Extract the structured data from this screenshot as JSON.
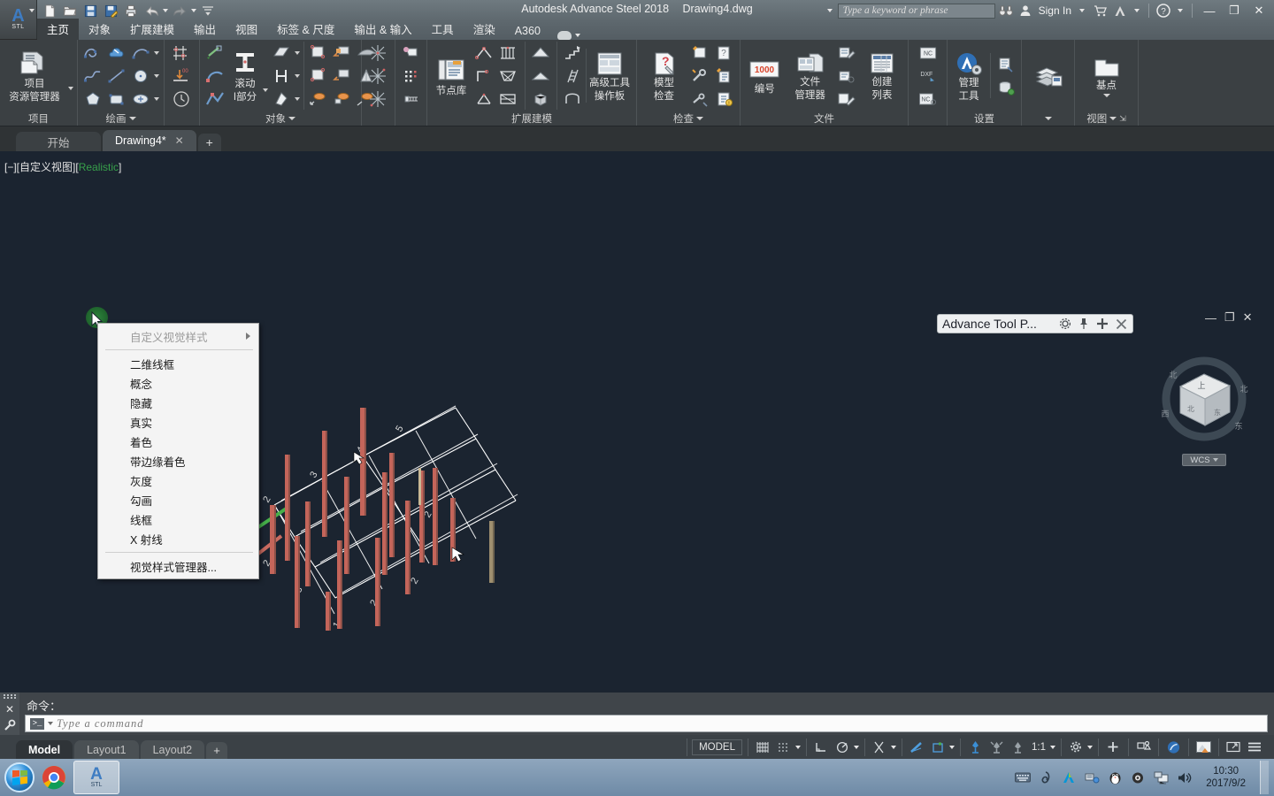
{
  "titlebar": {
    "app_name": "Autodesk Advance Steel 2018",
    "document": "Drawing4.dwg",
    "app_button_label": "STL",
    "quick_access": [
      {
        "name": "new-file-icon",
        "tip": "New"
      },
      {
        "name": "open-folder-icon",
        "tip": "Open"
      },
      {
        "name": "save-icon",
        "tip": "Save"
      },
      {
        "name": "save-as-icon",
        "tip": "Save As"
      },
      {
        "name": "plot-icon",
        "tip": "Plot"
      },
      {
        "name": "undo-icon",
        "tip": "Undo"
      },
      {
        "name": "redo-icon",
        "tip": "Redo"
      },
      {
        "name": "customize-qat-icon",
        "tip": "Customize"
      }
    ],
    "search_placeholder": "Type a keyword or phrase",
    "sign_in": "Sign In",
    "right_icons": [
      "binoculars-icon",
      "user-icon",
      "cart-icon",
      "autodesk-a-icon",
      "help-icon"
    ],
    "window_controls": [
      "minimize-icon",
      "restore-icon",
      "close-icon"
    ]
  },
  "menu": {
    "tabs": [
      {
        "label": "主页",
        "active": true
      },
      {
        "label": "对象",
        "active": false
      },
      {
        "label": "扩展建模",
        "active": false
      },
      {
        "label": "输出",
        "active": false
      },
      {
        "label": "视图",
        "active": false
      },
      {
        "label": "标签 & 尺度",
        "active": false
      },
      {
        "label": "输出 & 输入",
        "active": false
      },
      {
        "label": "工具",
        "active": false
      },
      {
        "label": "渲染",
        "active": false
      },
      {
        "label": "A360",
        "active": false
      }
    ]
  },
  "ribbon": {
    "panels": [
      {
        "title": "项目",
        "has_dropdown": false,
        "big_buttons": [
          {
            "label_line1": "项目",
            "label_line2": "资源管理器",
            "icon": "project-explorer-icon",
            "has_flyout": true
          }
        ],
        "small_buttons": []
      },
      {
        "title": "绘画",
        "has_dropdown": true,
        "big_buttons": [],
        "small_buttons": [
          "polyline-icon",
          "revision-cloud-icon",
          "arc-icon",
          "spline-icon",
          "line-icon",
          "circle-icon",
          "polygon-icon",
          "rectangle-icon",
          "ellipse-icon"
        ]
      },
      {
        "title": "",
        "has_dropdown": false,
        "big_buttons": [],
        "small_buttons": [
          "grid-axis-icon",
          "floor-level-icon",
          "clock-icon"
        ]
      },
      {
        "title": "对象",
        "has_dropdown": true,
        "big_buttons": [
          {
            "label_line1": "滚动",
            "label_line2": "I部分",
            "icon": "i-beam-icon",
            "has_flyout": true
          }
        ],
        "small_buttons": [
          "beam-start-icon",
          "beam-curve-icon",
          "beam-poly-icon",
          "plate-icon",
          "plate-fold-icon",
          "plate-bend-icon",
          "bolt-icon",
          "weld-icon",
          "anchor-icon"
        ]
      },
      {
        "title": "",
        "has_dropdown": false,
        "big_buttons": [],
        "small_buttons": [
          "grating-icon",
          "grating-2-icon",
          "shear-stud-icon"
        ]
      },
      {
        "title": "扩展建模",
        "has_dropdown": false,
        "big_buttons": [
          {
            "label_line1": "节点库",
            "label_line2": "",
            "icon": "connection-vault-icon",
            "has_flyout": false
          },
          {
            "label_line1": "高级工具",
            "label_line2": "操作板",
            "icon": "advanced-tool-palette-icon",
            "has_flyout": false
          }
        ],
        "small_buttons": [
          "portal-frame-icon",
          "truss-icon",
          "frame-icon",
          "lattice-icon",
          "bracing-icon",
          "purlin-icon",
          "roof-icon",
          "wall-icon",
          "box-icon",
          "stair-icon",
          "ladder-icon",
          "railing-icon"
        ]
      },
      {
        "title": "检查",
        "has_dropdown": true,
        "big_buttons": [
          {
            "label_line1": "模型",
            "label_line2": "检查",
            "icon": "model-check-icon",
            "has_flyout": false
          }
        ],
        "small_buttons": [
          "audit-icon",
          "unknown-icon",
          "tools-check-icon",
          "update-icon",
          "clash-check-icon",
          "warning-list-icon"
        ]
      },
      {
        "title": "文件",
        "has_dropdown": false,
        "big_buttons": [
          {
            "label_line1": "编号",
            "label_line2": "",
            "icon": "numbering-icon",
            "has_flyout": false
          },
          {
            "label_line1": "文件",
            "label_line2": "管理器",
            "icon": "document-manager-icon",
            "has_flyout": false
          },
          {
            "label_line1": "创建",
            "label_line2": "列表",
            "icon": "create-list-icon",
            "has_flyout": false
          }
        ],
        "small_buttons": [
          "drawing-process-icon",
          "drawing-style-icon",
          "drawing-edit-icon",
          "nc-icon",
          "dxf-icon",
          "nc-export-icon"
        ]
      },
      {
        "title": "设置",
        "has_dropdown": false,
        "big_buttons": [
          {
            "label_line1": "管理",
            "label_line2": "工具",
            "icon": "management-tools-icon",
            "has_flyout": false
          }
        ],
        "small_buttons": [
          "defaults-icon",
          "database-icon"
        ]
      },
      {
        "title": "",
        "has_dropdown": true,
        "big_buttons": [
          {
            "label_line1": "图层",
            "label_line2": "",
            "icon": "layers-icon",
            "has_flyout": false
          }
        ],
        "small_buttons": []
      },
      {
        "title": "视图",
        "has_dropdown": true,
        "big_buttons": [
          {
            "label_line1": "基点",
            "label_line2": "",
            "icon": "base-point-icon",
            "has_flyout": true
          }
        ],
        "small_buttons": []
      }
    ]
  },
  "file_tabs": {
    "tabs": [
      {
        "label": "开始",
        "active": false,
        "closable": false
      },
      {
        "label": "Drawing4*",
        "active": true,
        "closable": true
      }
    ],
    "close_glyph": "✕",
    "new_tab_glyph": "+"
  },
  "canvas": {
    "viewport_label_prefix": "[−][自定义视图][",
    "viewport_visual_style": "Realistic",
    "viewport_label_suffix": "]",
    "viewcube": {
      "faces": [
        "上",
        "北",
        "西",
        "东"
      ],
      "wcs_label": "WCS"
    }
  },
  "context_menu": {
    "items": [
      {
        "label": "自定义视觉样式",
        "dim": true,
        "submenu": true,
        "separator_after": true
      },
      {
        "label": "二维线框",
        "dim": false,
        "submenu": false,
        "separator_after": false
      },
      {
        "label": "概念",
        "dim": false,
        "submenu": false,
        "separator_after": false
      },
      {
        "label": "隐藏",
        "dim": false,
        "submenu": false,
        "separator_after": false
      },
      {
        "label": "真实",
        "dim": false,
        "submenu": false,
        "separator_after": false
      },
      {
        "label": "着色",
        "dim": false,
        "submenu": false,
        "separator_after": false
      },
      {
        "label": "带边缘着色",
        "dim": false,
        "submenu": false,
        "separator_after": false
      },
      {
        "label": "灰度",
        "dim": false,
        "submenu": false,
        "separator_after": false
      },
      {
        "label": "勾画",
        "dim": false,
        "submenu": false,
        "separator_after": false
      },
      {
        "label": "线框",
        "dim": false,
        "submenu": false,
        "separator_after": false
      },
      {
        "label": "X 射线",
        "dim": false,
        "submenu": false,
        "separator_after": true
      },
      {
        "label": "视觉样式管理器...",
        "dim": false,
        "submenu": false,
        "separator_after": false
      }
    ]
  },
  "tool_palette": {
    "title": "Advance Tool P...",
    "icons": [
      "gear-icon",
      "pin-icon",
      "move-icon",
      "close-icon"
    ],
    "window_controls": [
      "minimize-icon",
      "restore-icon",
      "close-icon"
    ]
  },
  "command_line": {
    "prompt_label": "命令：",
    "input_placeholder": "Type a command",
    "prompt_glyph": ">_",
    "close_glyph": "✕",
    "settings_glyph": "wrench-icon"
  },
  "status_bar": {
    "layout_tabs": [
      {
        "label": "Model",
        "active": true
      },
      {
        "label": "Layout1",
        "active": false
      },
      {
        "label": "Layout2",
        "active": false
      }
    ],
    "new_layout_glyph": "+",
    "space_toggle": "MODEL",
    "scale": "1:1",
    "tools": [
      "grid-display-icon",
      "snap-mode-icon",
      "ortho-icon",
      "polar-tracking-icon",
      "object-snap-icon",
      "osnap-tracking-icon",
      "lineweight-icon",
      "transparency-icon",
      "selection-cycling-icon",
      "annotation-visibility-icon",
      "annotation-scale-icon",
      "workspace-gear-icon",
      "add-tool-icon",
      "isolate-objects-icon",
      "graphics-performance-icon",
      "clean-screen-icon",
      "hardware-accel-icon",
      "customization-icon"
    ]
  },
  "taskbar": {
    "start_tip": "Start",
    "items": [
      {
        "name": "chrome-icon",
        "active": false
      },
      {
        "name": "advance-steel-icon",
        "active": true,
        "label": "STL"
      }
    ],
    "tray_icons": [
      "keyboard-icon",
      "ime-icon",
      "autodesk-tray-icon",
      "network-tray-icon",
      "qq-penguin-icon",
      "shield-icon",
      "monitor-icon",
      "volume-icon"
    ],
    "time": "10:30",
    "date": "2017/9/2"
  },
  "colors": {
    "ribbon_bg": "#3b4043",
    "titlebar_bg": "#5e686e",
    "canvas_bg": "#1b2430",
    "accent_blue": "#3e7cc2",
    "visual_style_green": "#37a04a",
    "steel_column": "#c56a5c",
    "grid_line": "#ffffff",
    "taskbar_bg": "#7e98b2"
  }
}
